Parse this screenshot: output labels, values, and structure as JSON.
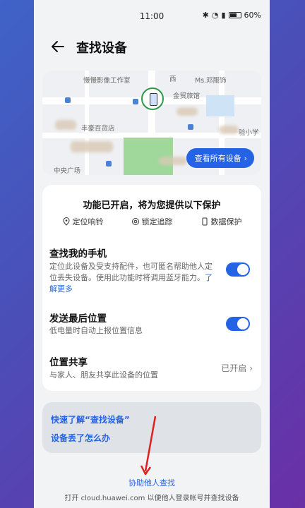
{
  "status_bar": {
    "time": "11:00",
    "battery": "60%"
  },
  "header": {
    "title": "查找设备"
  },
  "map": {
    "labels": [
      "慢慢影像工作室",
      "Ms.邓服饰",
      "西",
      "金贸旅馆",
      "丰豪百货店",
      "中央广场",
      "验小学"
    ],
    "view_all_label": "查看所有设备"
  },
  "protection": {
    "title": "功能已开启，将为您提供以下保护",
    "features": [
      "定位响铃",
      "锁定追踪",
      "数据保护"
    ]
  },
  "settings": [
    {
      "title": "查找我的手机",
      "description": "定位此设备及受支持配件，也可匿名帮助他人定位丢失设备。使用此功能时将调用蓝牙能力。",
      "link": "了解更多",
      "enabled": true
    },
    {
      "title": "发送最后位置",
      "description": "低电量时自动上报位置信息",
      "enabled": true
    },
    {
      "title": "位置共享",
      "description": "与家人、朋友共享此设备的位置",
      "status": "已开启"
    }
  ],
  "help": {
    "link1": "快速了解“查找设备”",
    "link2": "设备丢了怎么办"
  },
  "footer": {
    "link": "协助他人查找",
    "text": "打开 cloud.huawei.com 以便他人登录帐号并查找设备"
  },
  "colors": {
    "accent": "#2463e6",
    "marker": "#2d9a4a",
    "annotation_arrow": "#e02020"
  }
}
